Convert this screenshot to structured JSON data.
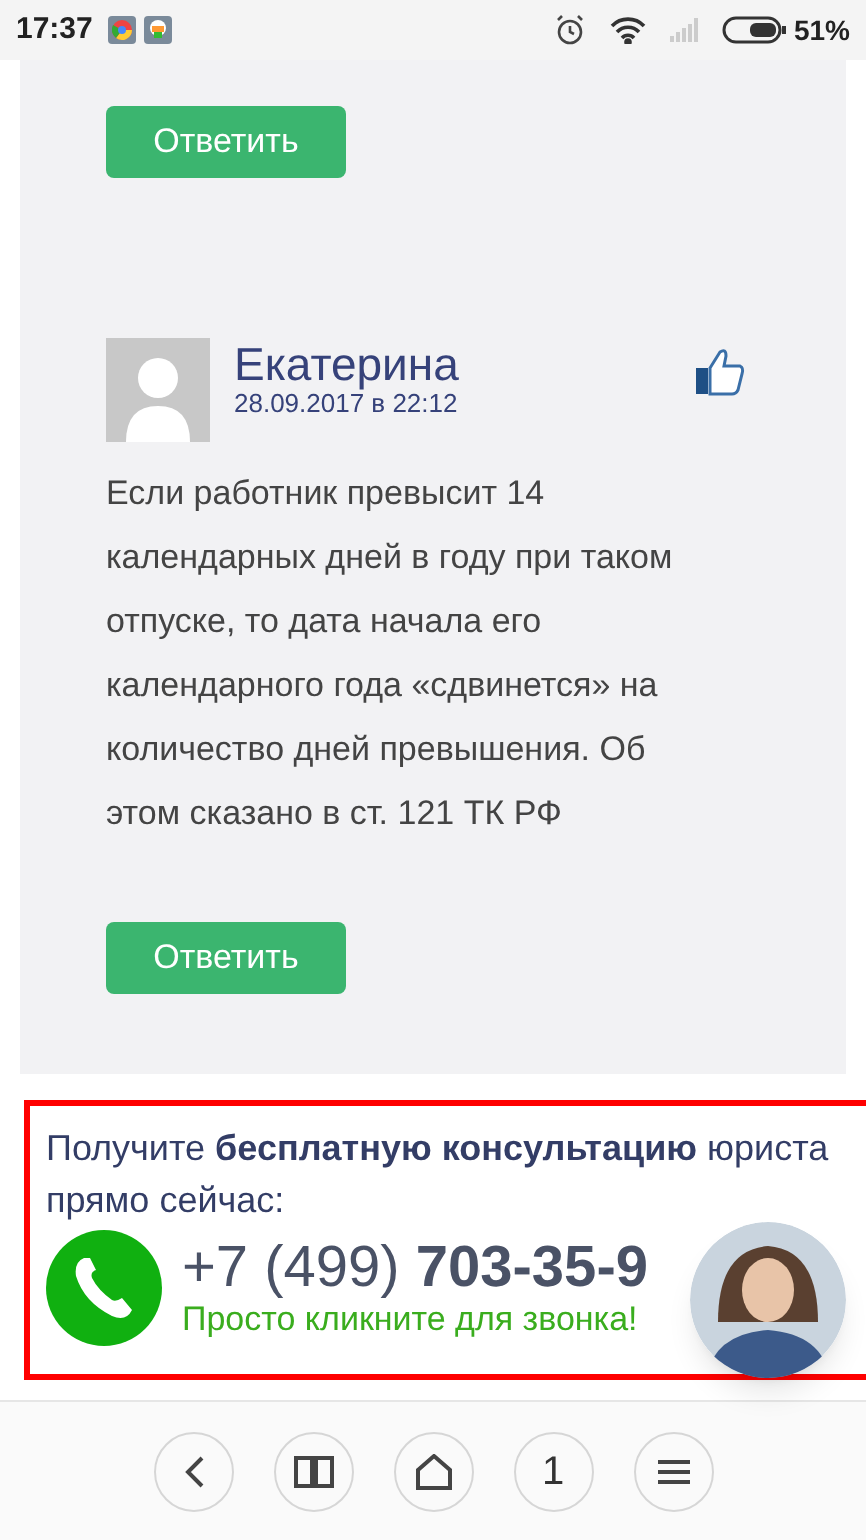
{
  "status_bar": {
    "time": "17:37",
    "battery": "51%"
  },
  "comments": [
    {
      "kind": "reply_only",
      "reply": "Ответить"
    },
    {
      "kind": "full",
      "author": "Екатерина",
      "date": "28.09.2017 в 22:12",
      "text": "Если работник превысит 14 календарных дней в году при таком отпуске, то дата начала его календарного года «сдвинется» на количество дней превышения. Об этом сказано в ст. 121 ТК РФ",
      "reply": "Ответить"
    }
  ],
  "callback_banner": {
    "headline": "Получите **бесплатную консультацию** юриста прямо сейчас:",
    "phone": "+7 (499) **703-35-9**",
    "hint": "Просто кликните для звонка!"
  },
  "bottom_nav": [
    {
      "kind": "back"
    },
    {
      "kind": "book"
    },
    {
      "kind": "home"
    },
    {
      "kind": "tabs",
      "label": "1"
    },
    {
      "kind": "menu"
    }
  ]
}
